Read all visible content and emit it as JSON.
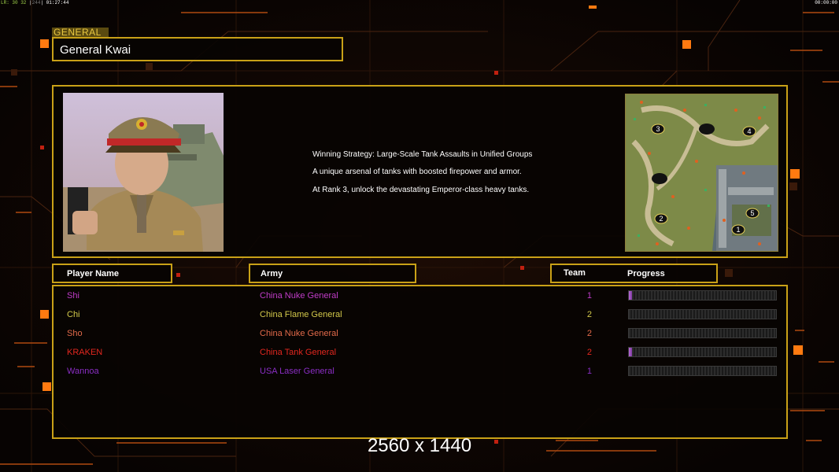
{
  "status_bar": {
    "left_stats": "LR: 30 32",
    "left_extra": "244",
    "left_time": "01:27:44",
    "right_time": "00:00:00"
  },
  "general_section": {
    "tag": "GENERAL",
    "name": "General Kwai"
  },
  "general_info": {
    "description_lines": [
      "Winning Strategy: Large-Scale Tank Assaults in Unified Groups",
      "A unique arsenal of tanks with boosted firepower and armor.",
      "At Rank 3, unlock the devastating Emperor-class heavy tanks."
    ],
    "portrait_icon": "general-portrait-icon",
    "map_icon": "minimap-icon",
    "map_start_positions": [
      "1",
      "2",
      "3",
      "4",
      "5"
    ]
  },
  "player_table": {
    "headers": {
      "player_name": "Player Name",
      "army": "Army",
      "team": "Team",
      "progress": "Progress"
    },
    "rows": [
      {
        "name": "Shi",
        "army": "China Nuke General",
        "team": "1",
        "progress": 0.02,
        "color": "#c03cc8"
      },
      {
        "name": "Chi",
        "army": "China Flame General",
        "team": "2",
        "progress": 0.0,
        "color": "#d2c84a"
      },
      {
        "name": "Sho",
        "army": "China Nuke General",
        "team": "2",
        "progress": 0.0,
        "color": "#e26a4a"
      },
      {
        "name": "KRAKEN",
        "army": "China Tank General",
        "team": "2",
        "progress": 0.02,
        "color": "#e2271f"
      },
      {
        "name": "Wannoa",
        "army": "USA Laser General",
        "team": "1",
        "progress": 0.0,
        "color": "#8a2ec4"
      }
    ]
  },
  "resolution_label": "2560 x 1440",
  "colors": {
    "accent_gold": "#c9a117",
    "ui_orange": "#ff6a00"
  }
}
